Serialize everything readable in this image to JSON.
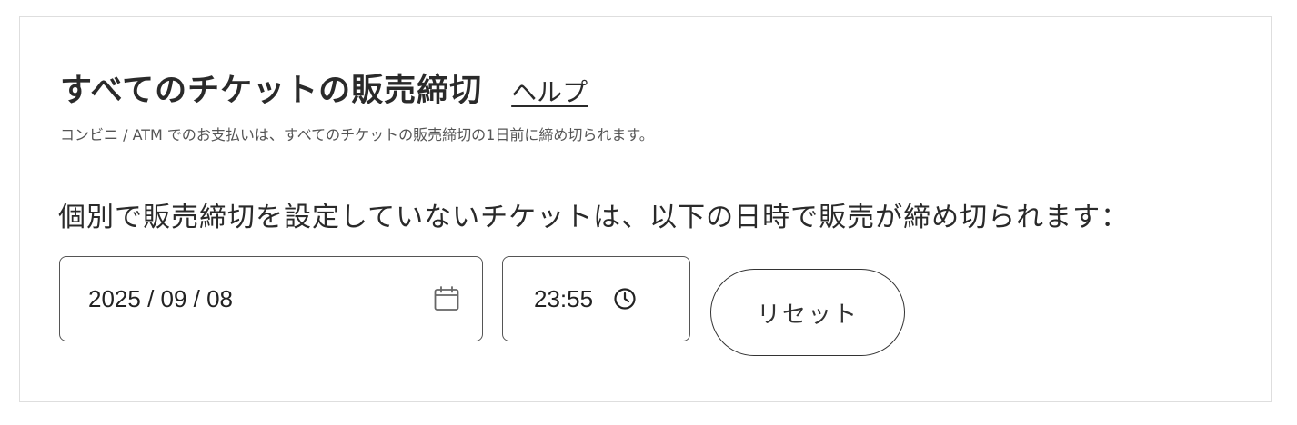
{
  "section": {
    "title": "すべてのチケットの販売締切",
    "help_label": "ヘルプ",
    "note": "コンビニ / ATM でのお支払いは、すべてのチケットの販売締切の1日前に締め切られます。",
    "instruction": "個別で販売締切を設定していないチケットは、以下の日時で販売が締め切られます："
  },
  "date_field": {
    "value": "2025 / 09 / 08",
    "icon": "calendar-icon"
  },
  "time_field": {
    "value": "23:55",
    "icon": "clock-icon"
  },
  "reset_button": {
    "label": "リセット"
  }
}
